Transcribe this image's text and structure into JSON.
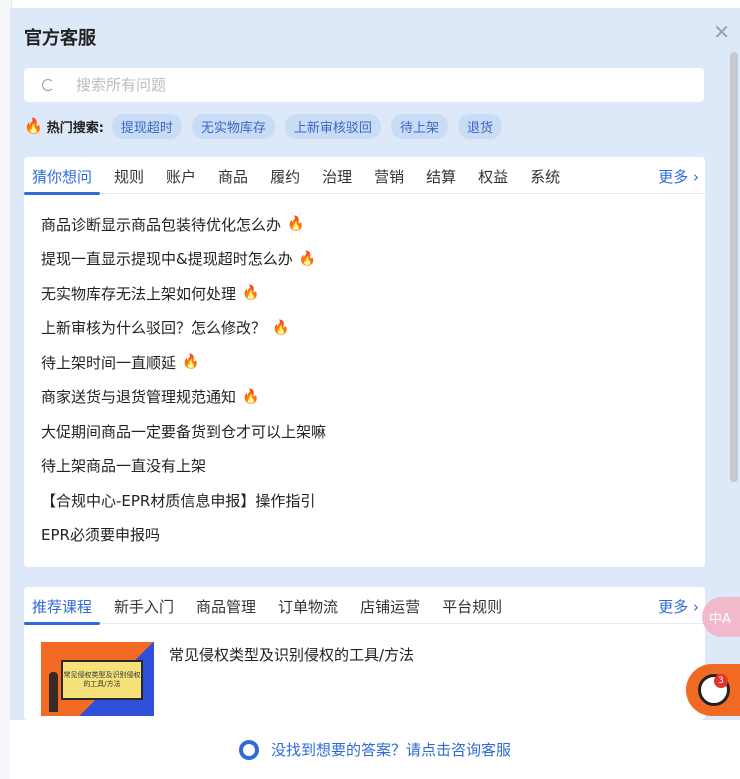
{
  "title": "官方客服",
  "search": {
    "placeholder": "搜索所有问题"
  },
  "hot": {
    "label": "热门搜索:",
    "tags": [
      "提现超时",
      "无实物库存",
      "上新审核驳回",
      "待上架",
      "退货"
    ]
  },
  "faq": {
    "tabs": [
      "猜你想问",
      "规则",
      "账户",
      "商品",
      "履约",
      "治理",
      "营销",
      "结算",
      "权益",
      "系统"
    ],
    "more": "更多",
    "items": [
      {
        "text": "商品诊断显示商品包装待优化怎么办",
        "hot": true
      },
      {
        "text": "提现一直显示提现中&提现超时怎么办",
        "hot": true
      },
      {
        "text": "无实物库存无法上架如何处理",
        "hot": true
      },
      {
        "text": "上新审核为什么驳回？怎么修改？",
        "hot": true
      },
      {
        "text": "待上架时间一直顺延",
        "hot": true
      },
      {
        "text": "商家送货与退货管理规范通知",
        "hot": true
      },
      {
        "text": "大促期间商品一定要备货到仓才可以上架嘛",
        "hot": false
      },
      {
        "text": "待上架商品一直没有上架",
        "hot": false
      },
      {
        "text": "【合规中心-EPR材质信息申报】操作指引",
        "hot": false
      },
      {
        "text": "EPR必须要申报吗",
        "hot": false
      }
    ]
  },
  "courses": {
    "tabs": [
      "推荐课程",
      "新手入门",
      "商品管理",
      "订单物流",
      "店铺运营",
      "平台规则"
    ],
    "more": "更多",
    "items": [
      {
        "title": "常见侵权类型及识别侵权的工具/方法",
        "thumb_text": "常见侵权类型及识别侵权的工具/方法"
      }
    ]
  },
  "footer": {
    "text": "没找到想要的答案？请点击咨询客服"
  },
  "float": {
    "translate": "中A",
    "badge": "3"
  },
  "colors": {
    "accent": "#2f6bd6",
    "panel": "#dde9f9",
    "orange": "#f06a23"
  }
}
